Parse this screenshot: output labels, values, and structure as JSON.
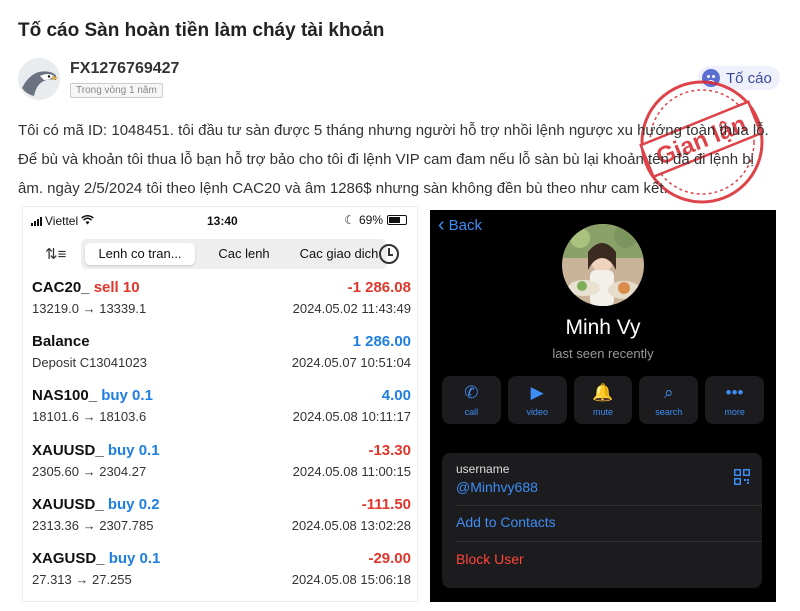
{
  "post": {
    "title": "Tố cáo Sàn hoàn tiền làm cháy tài khoản",
    "author": "FX1276769427",
    "time": "Trong vòng 1 năm",
    "report_label": "Tố cáo",
    "stamp_text": "Gian lận",
    "body": "Tôi có mã ID: 1048451. tôi đầu tư sàn được 5 tháng nhưng người hỗ trợ nhồi lệnh ngược xu hướng toàn thua lỗ. Để bù và khoản tôi thua lỗ bạn hỗ trợ bảo cho tôi đi lệnh VIP cam đam nếu lỗ sàn bù lại khoản tên đã đi lệnh bị âm. ngày 2/5/2024 tôi theo lệnh CAC20 và âm 1286$ nhưng sàn không đền bù theo như cam kết."
  },
  "left_phone": {
    "carrier": "Viettel",
    "time": "13:40",
    "battery": "69%",
    "battery_level": 0.69,
    "tabs": [
      "Lenh co tran...",
      "Cac lenh",
      "Cac giao dich"
    ],
    "active_tab": 0,
    "trades": [
      {
        "symbol": "CAC20_",
        "side": "sell 10",
        "side_color": "#e0362c",
        "amount": "-1 286.08",
        "amount_color": "#e0362c",
        "detail": "13219.0 → 13339.1",
        "date": "2024.05.02 11:43:49"
      },
      {
        "symbol": "Balance",
        "side": "",
        "side_color": "#111111",
        "amount": "1 286.00",
        "amount_color": "#1f7fe0",
        "detail": "Deposit C13041023",
        "date": "2024.05.07 10:51:04"
      },
      {
        "symbol": "NAS100_",
        "side": "buy 0.1",
        "side_color": "#1f7fe0",
        "amount": "4.00",
        "amount_color": "#1f7fe0",
        "detail": "18101.6 → 18103.6",
        "date": "2024.05.08 10:11:17"
      },
      {
        "symbol": "XAUUSD_",
        "side": "buy 0.1",
        "side_color": "#1f7fe0",
        "amount": "-13.30",
        "amount_color": "#e0362c",
        "detail": "2305.60 → 2304.27",
        "date": "2024.05.08 11:00:15"
      },
      {
        "symbol": "XAUUSD_",
        "side": "buy 0.2",
        "side_color": "#1f7fe0",
        "amount": "-111.50",
        "amount_color": "#e0362c",
        "detail": "2313.36 → 2307.785",
        "date": "2024.05.08 13:02:28"
      },
      {
        "symbol": "XAGUSD_",
        "side": "buy 0.1",
        "side_color": "#1f7fe0",
        "amount": "-29.00",
        "amount_color": "#e0362c",
        "detail": "27.313 → 27.255",
        "date": "2024.05.08 15:06:18"
      }
    ]
  },
  "right_phone": {
    "back_label": "Back",
    "name": "Minh Vy",
    "status": "last seen recently",
    "actions": [
      {
        "label": "call",
        "icon": "phone-icon",
        "glyph": "✆"
      },
      {
        "label": "video",
        "icon": "video-camera-icon",
        "glyph": "▶"
      },
      {
        "label": "mute",
        "icon": "bell-icon",
        "glyph": "🔔"
      },
      {
        "label": "search",
        "icon": "search-icon",
        "glyph": "⌕"
      },
      {
        "label": "more",
        "icon": "ellipsis-icon",
        "glyph": "•••"
      }
    ],
    "username_label": "username",
    "username": "@Minhvy688",
    "add_contact": "Add to Contacts",
    "block_user": "Block User"
  },
  "colors": {
    "accent_blue": "#3d8df5",
    "loss_red": "#e0362c",
    "gain_blue": "#1f7fe0",
    "stamp_red": "#d9232a"
  }
}
